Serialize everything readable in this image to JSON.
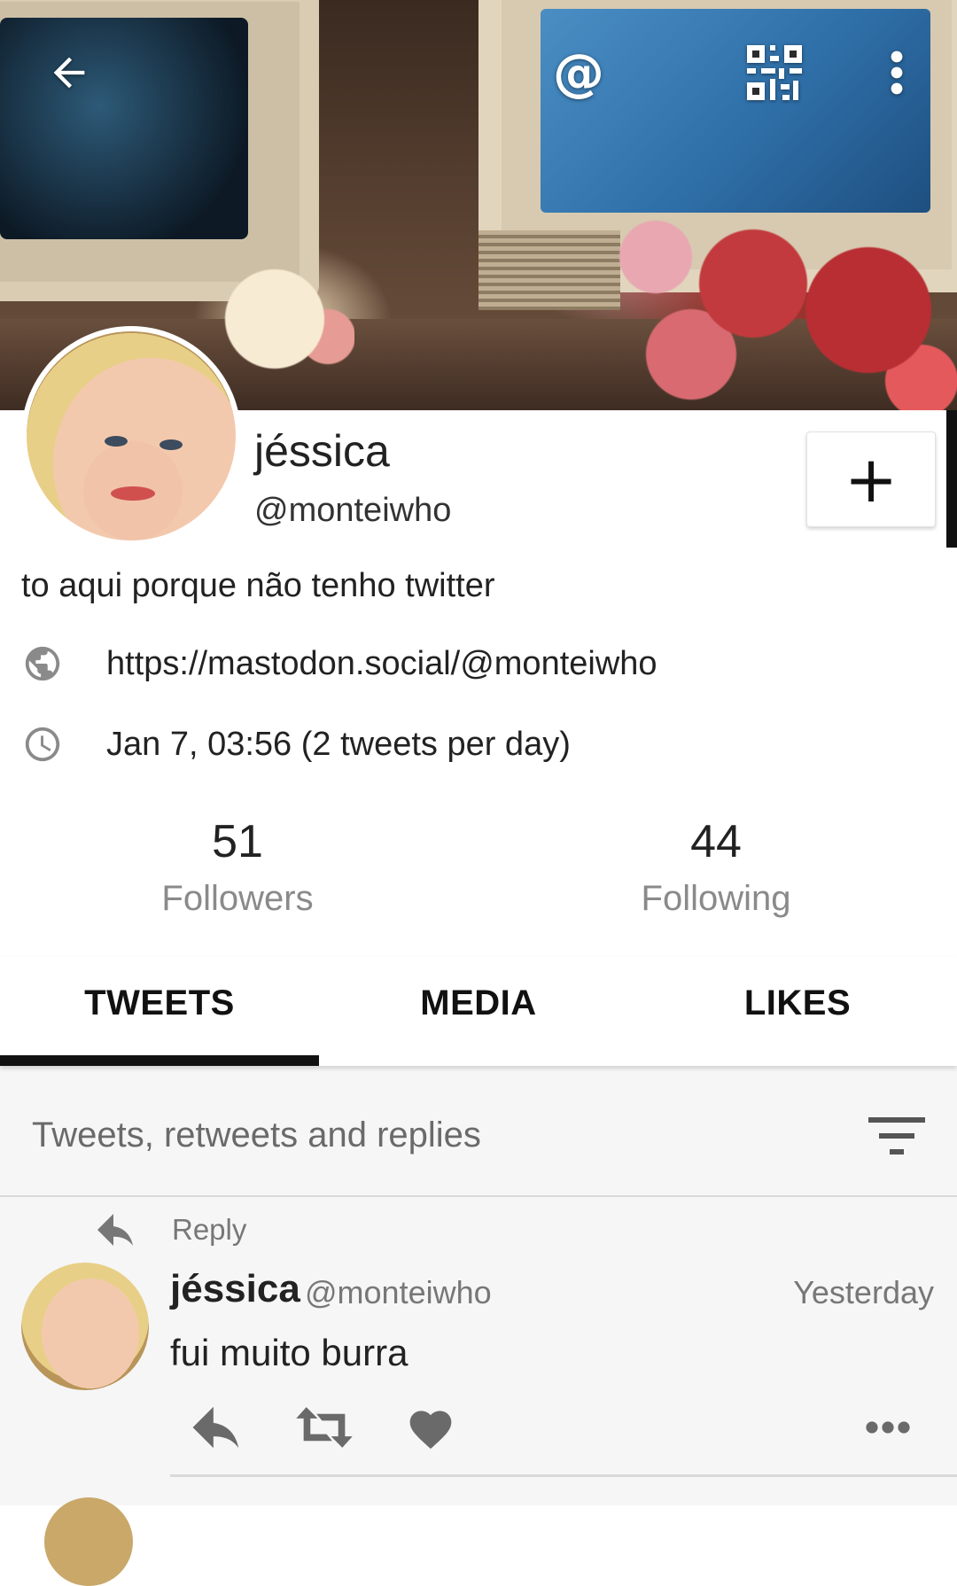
{
  "profile": {
    "display_name": "jéssica",
    "handle": "@monteiwho",
    "bio": "to aqui porque não tenho twitter",
    "website": "https://mastodon.social/@monteiwho",
    "joined": "Jan 7, 03:56 (2 tweets per day)",
    "followers_count": "51",
    "followers_label": "Followers",
    "following_count": "44",
    "following_label": "Following",
    "follow_button_label": "+"
  },
  "tabs": [
    {
      "label": "TWEETS",
      "selected": true
    },
    {
      "label": "MEDIA",
      "selected": false
    },
    {
      "label": "LIKES",
      "selected": false
    }
  ],
  "timeline": {
    "filter_label": "Tweets, retweets and replies",
    "tweets": [
      {
        "context": "Reply",
        "author_name": "jéssica",
        "author_handle": "@monteiwho",
        "time": "Yesterday",
        "text": "fui muito burra"
      }
    ]
  },
  "icons": {
    "topbar": [
      "back-arrow-icon",
      "at-sign-icon",
      "qr-code-icon",
      "overflow-menu-icon"
    ],
    "meta": [
      "globe-icon",
      "clock-icon"
    ],
    "tweet_actions": [
      "reply-icon",
      "retweet-icon",
      "like-heart-icon",
      "more-dots-icon"
    ]
  },
  "colors": {
    "tab_indicator": "#111111",
    "muted_text": "#8a8a8a",
    "timeline_bg": "#f6f6f6"
  }
}
